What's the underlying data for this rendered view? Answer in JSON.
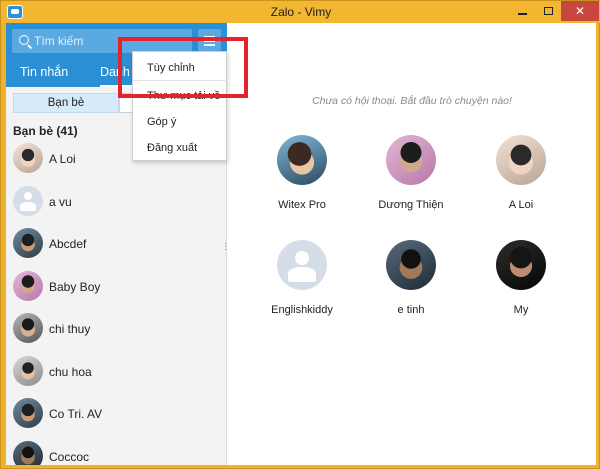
{
  "window": {
    "title": "Zalo - Vimy",
    "controls": {
      "minimize_icon": "minimize-icon",
      "maximize_icon": "maximize-icon",
      "close_icon": "close-icon",
      "close_glyph": "✕"
    }
  },
  "sidebar": {
    "search": {
      "placeholder": "Tìm kiếm",
      "value": "",
      "icon": "search-icon"
    },
    "menu_button_icon": "hamburger-icon",
    "tabs": [
      {
        "label": "Tin nhắn",
        "active": false
      },
      {
        "label": "Danh bạ",
        "active": true
      }
    ],
    "segments": [
      {
        "label": "Bạn bè",
        "active": true
      }
    ],
    "friends_header": "Bạn bè (41)",
    "friends": [
      {
        "name": "A Loi",
        "avatar": "ph-photo3"
      },
      {
        "name": "a vu",
        "avatar": "ph-default"
      },
      {
        "name": "Abcdef",
        "avatar": "ph-photo6"
      },
      {
        "name": "Baby Boy",
        "avatar": "ph-photo2"
      },
      {
        "name": "chi thuy",
        "avatar": "ph-photo7"
      },
      {
        "name": "chu hoa",
        "avatar": "ph-photo8"
      },
      {
        "name": "Co Tri. AV",
        "avatar": "ph-photo6"
      },
      {
        "name": "Coccoc",
        "avatar": "ph-photo4"
      }
    ]
  },
  "dropdown_menu": {
    "items": [
      {
        "label": "Tùy chỉnh"
      },
      {
        "label": "Thư mục tải về"
      },
      {
        "label": "Góp ý"
      },
      {
        "label": "Đăng xuất"
      }
    ]
  },
  "annotation": {
    "color": "#e5232e"
  },
  "main": {
    "empty_text": "Chưa có hội thoại. Bắt đầu trò chuyện nào!",
    "recent_contacts": [
      {
        "name": "Witex Pro",
        "avatar": "ph-photo1"
      },
      {
        "name": "Dương Thiện",
        "avatar": "ph-photo2"
      },
      {
        "name": "A Loi",
        "avatar": "ph-photo3"
      },
      {
        "name": "Englishkiddy",
        "avatar": "ph-default"
      },
      {
        "name": "e tinh",
        "avatar": "ph-photo4"
      },
      {
        "name": "My",
        "avatar": "ph-photo5"
      }
    ]
  },
  "colors": {
    "accent_blue": "#2a8fd4",
    "title_bar": "#f2b630",
    "close_red": "#c7463d"
  }
}
